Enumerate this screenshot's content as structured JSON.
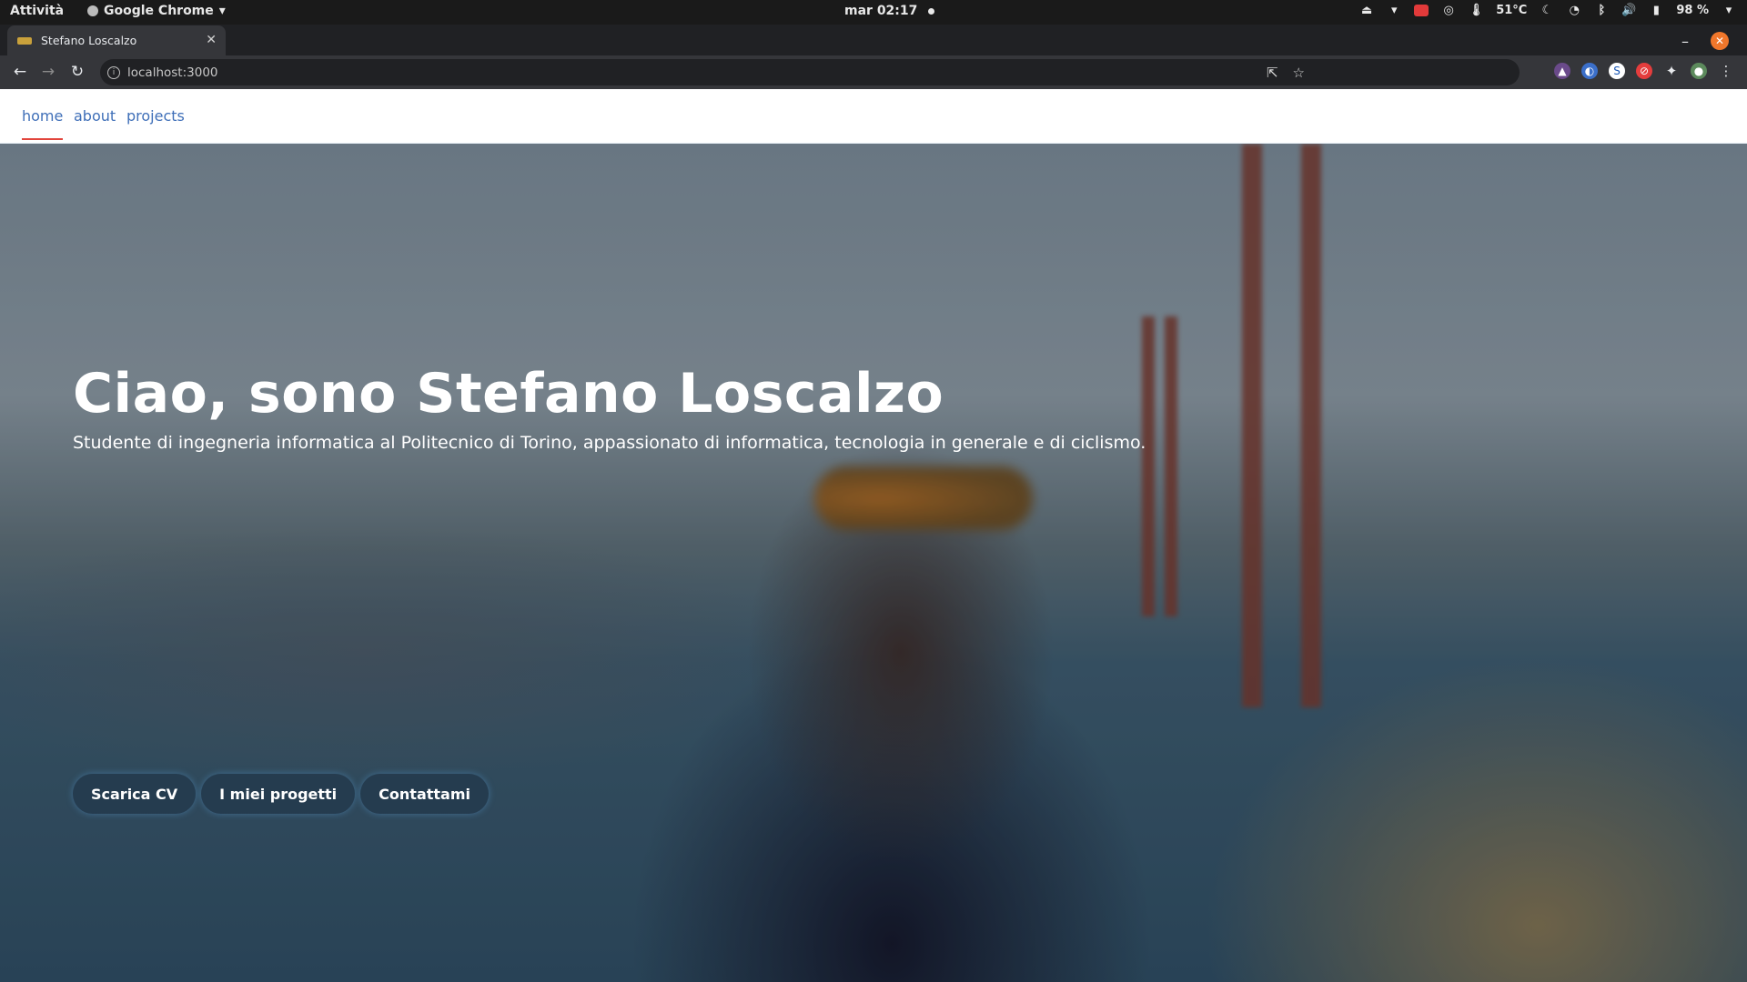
{
  "system": {
    "activities": "Attività",
    "app_name": "Google Chrome",
    "clock": "mar 02:17",
    "temperature": "51°C",
    "battery": "98 %"
  },
  "browser": {
    "tab_title": "Stefano Loscalzo",
    "url": "localhost:3000"
  },
  "site": {
    "nav": [
      "home",
      "about",
      "projects"
    ],
    "active_nav": "home",
    "headline": "Ciao, sono Stefano Loscalzo",
    "subheadline": "Studente di ingegneria informatica al Politecnico di Torino, appassionato di informatica, tecnologia in generale e di ciclismo.",
    "buttons": [
      "Scarica CV",
      "I miei progetti",
      "Contattami"
    ],
    "colors": {
      "nav_link": "#3f6fb8",
      "nav_active_underline": "#e2453c",
      "hero_text": "#ffffff"
    }
  }
}
